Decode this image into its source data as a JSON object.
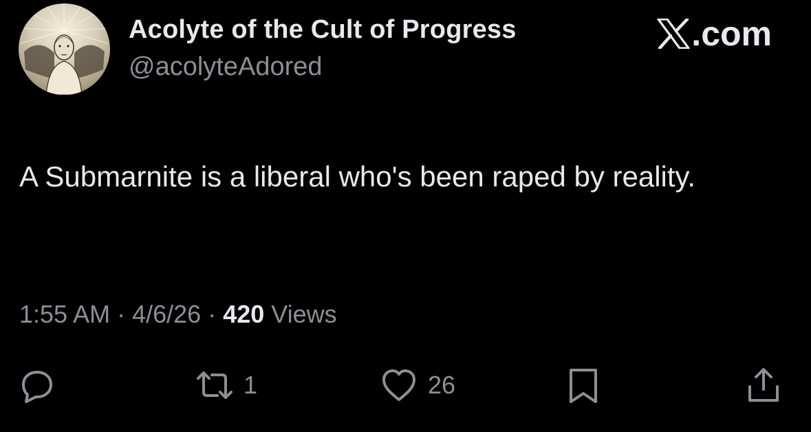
{
  "author": {
    "display_name": "Acolyte of the Cult of Progress",
    "handle": "@acolyteAdored",
    "avatar": "avatar-angel-figure"
  },
  "brand": {
    "logo": "x-logo-icon",
    "domain": ".com"
  },
  "tweet": {
    "text": "A Submarnite is a liberal who's been raped by reality."
  },
  "meta": {
    "time": "1:55 AM",
    "separator": "·",
    "date": "4/6/26",
    "views_count": "420",
    "views_label": "Views"
  },
  "actions": {
    "reply": {
      "icon": "reply-icon",
      "count": ""
    },
    "repost": {
      "icon": "repost-icon",
      "count": "1"
    },
    "like": {
      "icon": "heart-icon",
      "count": "26"
    },
    "bookmark": {
      "icon": "bookmark-icon",
      "count": ""
    },
    "share": {
      "icon": "share-icon",
      "count": ""
    }
  },
  "colors": {
    "background": "#000000",
    "primary_text": "#e7e9ea",
    "secondary_text": "#8b9096"
  }
}
